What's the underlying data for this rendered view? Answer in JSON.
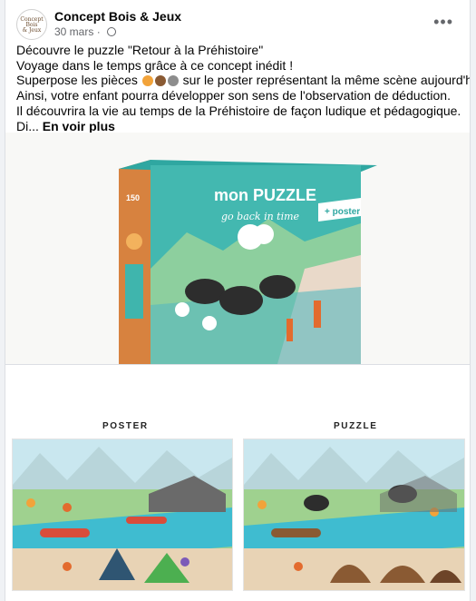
{
  "post": {
    "page_name": "Concept Bois & Jeux",
    "avatar_text": [
      "Concept",
      "Bois",
      "& Jeux"
    ],
    "date": "30 mars",
    "lines": [
      "Découvre le puzzle \"Retour à la Préhistoire\"",
      "Voyage dans le temps grâce à ce concept inédit !",
      "Ainsi, votre enfant pourra développer son sens de l'observation de déduction.",
      "Il découvrira la vie au temps de la Préhistoire de façon ludique et pédagogique."
    ],
    "line3_before": "Superpose les pièces",
    "line3_after": "sur le poster représentant la même scène aujourd'hui.",
    "truncated": "Di...",
    "see_more": "En voir plus"
  },
  "product": {
    "box_title": "mon PUZZLE",
    "box_subtitle": "go back in time",
    "box_badge": "+ poster",
    "box_count": "150"
  },
  "captions": {
    "poster": "POSTER",
    "puzzle": "PUZZLE"
  },
  "colors": {
    "teal": "#3fb5ad",
    "orange": "#e36b2e",
    "accent": "#1877f2"
  },
  "icons": [
    "globe-icon",
    "more-options-icon"
  ]
}
